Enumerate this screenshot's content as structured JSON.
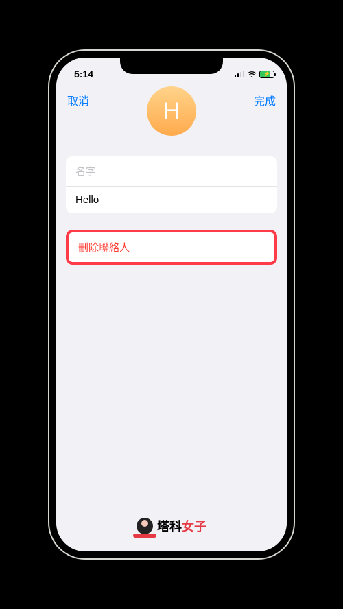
{
  "status": {
    "time": "5:14"
  },
  "nav": {
    "cancel": "取消",
    "done": "完成",
    "avatar_initial": "H"
  },
  "fields": {
    "name_placeholder": "名字",
    "value": "Hello"
  },
  "actions": {
    "delete_label": "刪除聯絡人"
  },
  "watermark": {
    "part1": "塔科",
    "part2": "女子"
  }
}
